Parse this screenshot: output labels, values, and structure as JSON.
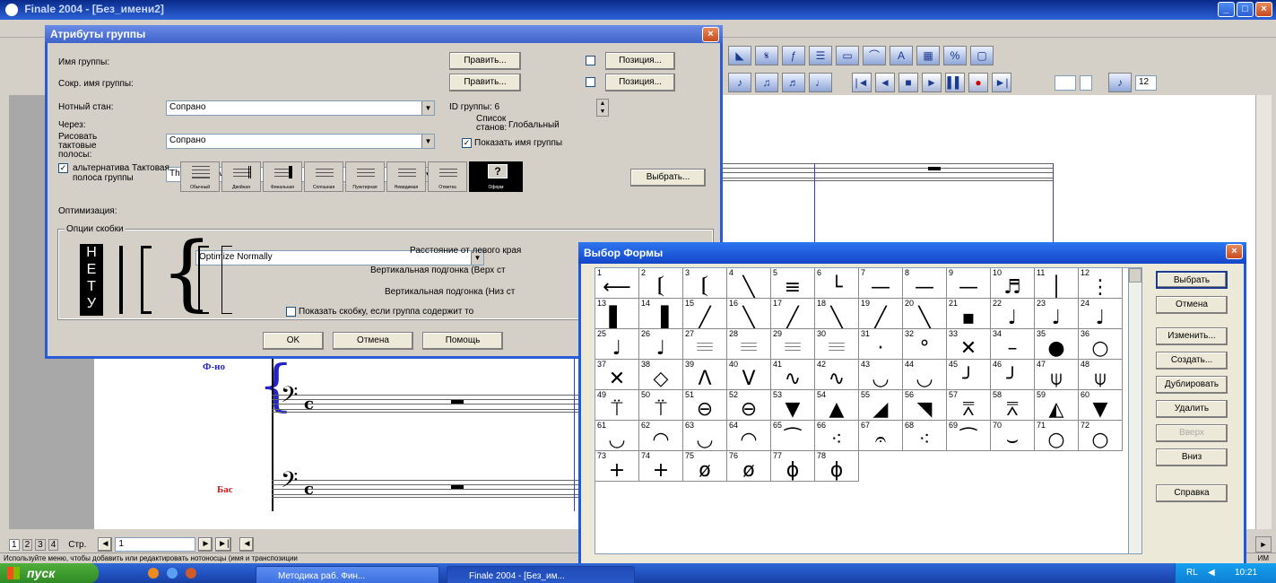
{
  "app": {
    "title": "Finale 2004 - [Без_имени2]",
    "min": "_",
    "max": "□",
    "close": "×"
  },
  "score": {
    "staff_labels": [
      "Ф-но",
      "Бас"
    ],
    "label_colors": [
      "#2424c8",
      "#d01818"
    ],
    "clef": "𝄢",
    "time": "c",
    "rest": "▬"
  },
  "bottom_nav": {
    "tabs": [
      "1",
      "2",
      "3",
      "4"
    ],
    "page_label": "Стр.",
    "page_value": "1",
    "prev_page": "◄",
    "next_page": "►",
    "last_page": "►|"
  },
  "status": {
    "message": "Используйте меню, чтобы добавить или редактировать нотоносцы (имя и транспозиции",
    "right": "ИМ"
  },
  "toolbar": {
    "zoom_value": "12"
  },
  "group_dialog": {
    "title": "Атрибуты группы",
    "close": "×",
    "group_name_label": "Имя группы:",
    "short_name_label": "Сокр. имя группы:",
    "edit_button": "Править...",
    "position_button": "Позиция...",
    "staff_label": "Нотный стан:",
    "staff_value": "Сопрано",
    "through_label": "Через:",
    "through_value": "Сопрано",
    "draw_barlines_label": "Рисовать тактовые полосы:",
    "draw_barlines_value": "Through Staves",
    "group_id_label": "ID группы:",
    "group_id_value": "6",
    "staff_list_label": "Список станов:",
    "staff_list_value": "Глобальный",
    "show_group_name": "Показать имя группы",
    "alt_barline_label": "альтернатива Тактовая полоса группы",
    "barline_types": [
      "Обычный",
      "Двойная",
      "Финальная",
      "Сплошная",
      "Пунктирная",
      "Невидимая",
      "Отметка",
      "Оформ"
    ],
    "select_button": "Выбрать...",
    "optimization_label": "Оптимизация:",
    "optimization_value": "Optimize Normally",
    "bracket_options_label": "Опции скобки",
    "none_letters": [
      "Н",
      "Е",
      "Т",
      "У"
    ],
    "distance_label": "Расстояние от левого края",
    "vadj_top_label": "Вертикальная подгонка (Верх ст",
    "vadj_bottom_label": "Вертикальная подгонка (Низ ст",
    "show_bracket_label": "Показать скобку, если группа содержит то",
    "ok": "OK",
    "cancel": "Отмена",
    "help": "Помощь"
  },
  "shape_dialog": {
    "title": "Выбор Формы",
    "close": "×",
    "cells": [
      {
        "n": "1",
        "s": "⟵"
      },
      {
        "n": "2",
        "s": "𝄕"
      },
      {
        "n": "3",
        "s": "𝄕"
      },
      {
        "n": "4",
        "s": "╲"
      },
      {
        "n": "5",
        "s": "≡"
      },
      {
        "n": "6",
        "s": "└"
      },
      {
        "n": "7",
        "s": "—"
      },
      {
        "n": "8",
        "s": "—"
      },
      {
        "n": "9",
        "s": "—"
      },
      {
        "n": "10",
        "s": "♬"
      },
      {
        "n": "11",
        "s": "│"
      },
      {
        "n": "12",
        "s": "⋮"
      },
      {
        "n": "13",
        "s": "▌"
      },
      {
        "n": "14",
        "s": "▐"
      },
      {
        "n": "15",
        "s": "╱"
      },
      {
        "n": "16",
        "s": "╲"
      },
      {
        "n": "17",
        "s": "╱"
      },
      {
        "n": "18",
        "s": "╲"
      },
      {
        "n": "19",
        "s": "╱"
      },
      {
        "n": "20",
        "s": "╲"
      },
      {
        "n": "21",
        "s": "▪"
      },
      {
        "n": "22",
        "s": "♩"
      },
      {
        "n": "23",
        "s": "♩"
      },
      {
        "n": "24",
        "s": "♩"
      },
      {
        "n": "25",
        "s": "♩"
      },
      {
        "n": "26",
        "s": "♩"
      },
      {
        "n": "27",
        "s": "𝄘"
      },
      {
        "n": "28",
        "s": "𝄘"
      },
      {
        "n": "29",
        "s": "𝄘"
      },
      {
        "n": "30",
        "s": "𝄘"
      },
      {
        "n": "31",
        "s": "·"
      },
      {
        "n": "32",
        "s": "°"
      },
      {
        "n": "33",
        "s": "✕"
      },
      {
        "n": "34",
        "s": "–"
      },
      {
        "n": "35",
        "s": "●"
      },
      {
        "n": "36",
        "s": "○"
      },
      {
        "n": "37",
        "s": "✕"
      },
      {
        "n": "38",
        "s": "◇"
      },
      {
        "n": "39",
        "s": "Λ"
      },
      {
        "n": "40",
        "s": "V"
      },
      {
        "n": "41",
        "s": "∿"
      },
      {
        "n": "42",
        "s": "∿"
      },
      {
        "n": "43",
        "s": "◡"
      },
      {
        "n": "44",
        "s": "◡"
      },
      {
        "n": "45",
        "s": "╯"
      },
      {
        "n": "46",
        "s": "╯"
      },
      {
        "n": "47",
        "s": "⍦"
      },
      {
        "n": "48",
        "s": "⍦"
      },
      {
        "n": "49",
        "s": "⍡"
      },
      {
        "n": "50",
        "s": "⍡"
      },
      {
        "n": "51",
        "s": "⊖"
      },
      {
        "n": "52",
        "s": "⊖"
      },
      {
        "n": "53",
        "s": "▼"
      },
      {
        "n": "54",
        "s": "▲"
      },
      {
        "n": "55",
        "s": "◢"
      },
      {
        "n": "56",
        "s": "◥"
      },
      {
        "n": "57",
        "s": "⩞"
      },
      {
        "n": "58",
        "s": "⩞"
      },
      {
        "n": "59",
        "s": "◭"
      },
      {
        "n": "60",
        "s": "▼"
      },
      {
        "n": "61",
        "s": "◡"
      },
      {
        "n": "62",
        "s": "◠"
      },
      {
        "n": "63",
        "s": "◡"
      },
      {
        "n": "64",
        "s": "◠"
      },
      {
        "n": "65",
        "s": "⁀"
      },
      {
        "n": "66",
        "s": "⁖"
      },
      {
        "n": "67",
        "s": "𝄐"
      },
      {
        "n": "68",
        "s": "⁖"
      },
      {
        "n": "69",
        "s": "⁀"
      },
      {
        "n": "70",
        "s": "⌣"
      },
      {
        "n": "71",
        "s": "○"
      },
      {
        "n": "72",
        "s": "○"
      },
      {
        "n": "73",
        "s": "+"
      },
      {
        "n": "74",
        "s": "+"
      },
      {
        "n": "75",
        "s": "ø"
      },
      {
        "n": "76",
        "s": "ø"
      },
      {
        "n": "77",
        "s": "ϕ"
      },
      {
        "n": "78",
        "s": "ϕ"
      }
    ],
    "buttons": [
      "Выбрать",
      "Отмена",
      "Изменить...",
      "Создать...",
      "Дублировать",
      "Удалить",
      "Вверх",
      "Вниз",
      "Справка"
    ]
  },
  "taskbar": {
    "start": "пуск",
    "tasks": [
      "Методика раб. Фин...",
      "Finale 2004 - [Без_им..."
    ],
    "lang": "RL",
    "clock": "10:21"
  }
}
